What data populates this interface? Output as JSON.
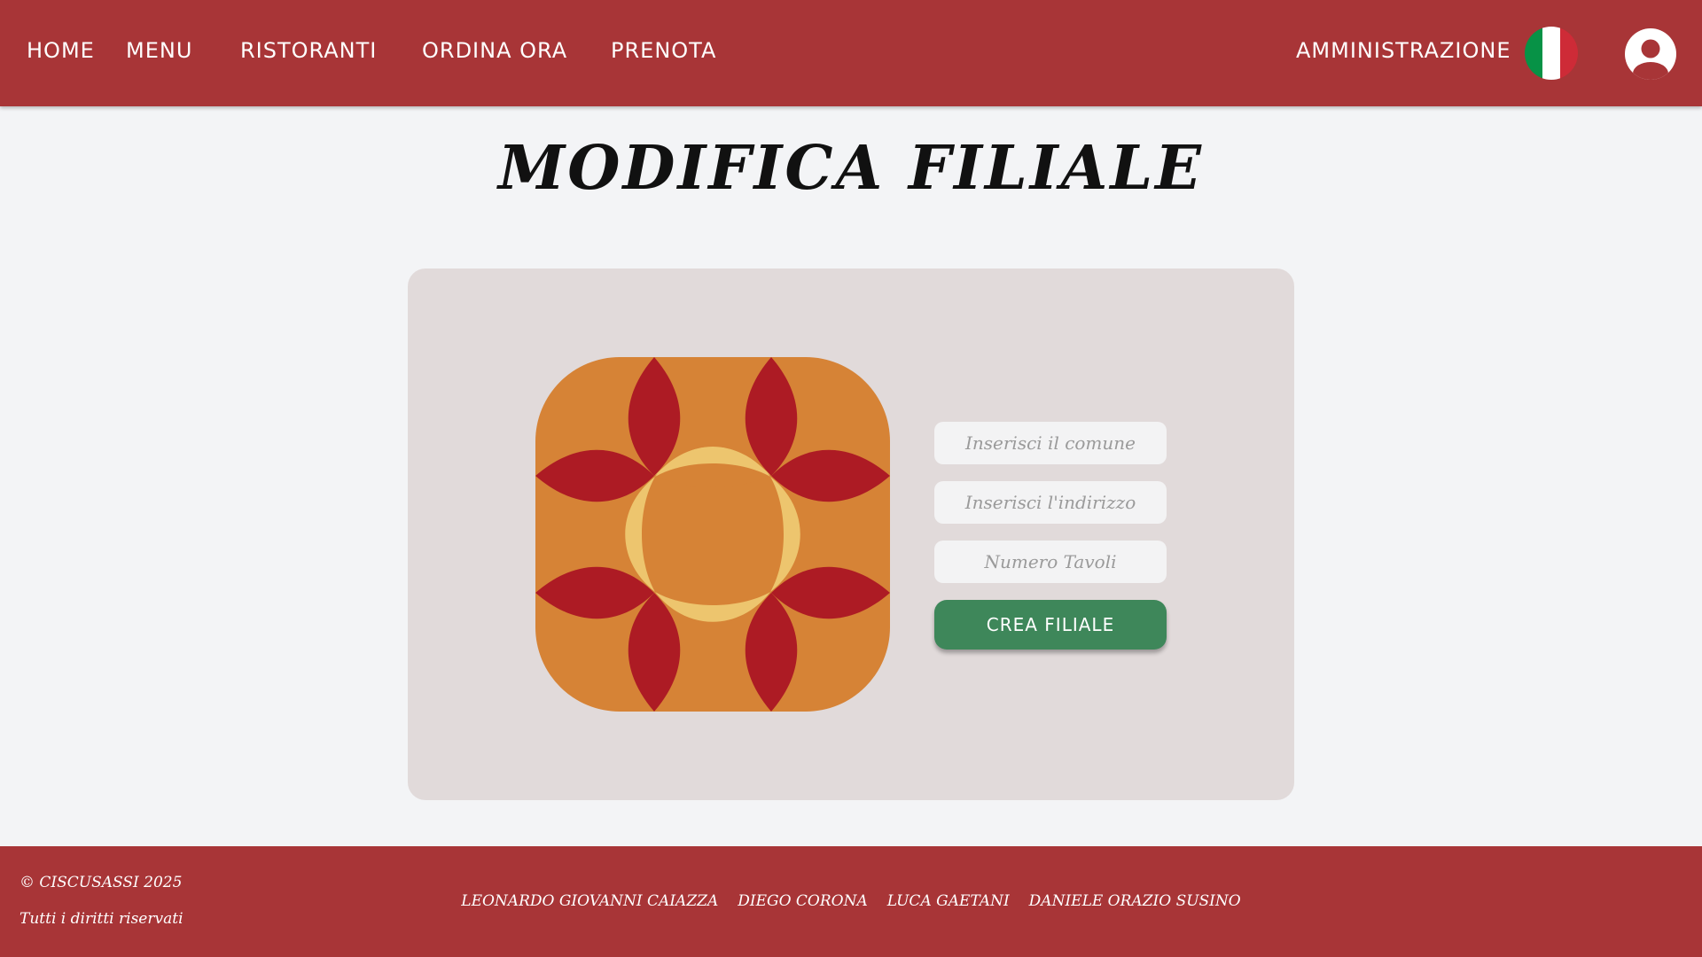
{
  "nav": {
    "home": "HOME",
    "menu": "MENU",
    "ristoranti": "RISTORANTI",
    "ordina": "ORDINA ORA",
    "prenota": "PRENOTA",
    "admin": "AMMINISTRAZIONE"
  },
  "icons": {
    "flag": "italian-flag-icon",
    "avatar": "user-avatar-icon",
    "logo": "restaurant-logo"
  },
  "page": {
    "title": "MODIFICA FILIALE"
  },
  "form": {
    "comune_placeholder": "Inserisci il comune",
    "indirizzo_placeholder": "Inserisci l'indirizzo",
    "tavoli_placeholder": "Numero Tavoli",
    "comune_value": "",
    "indirizzo_value": "",
    "tavoli_value": "",
    "submit_label": "CREA FILIALE"
  },
  "footer": {
    "copyright": "© CISCUSASSI 2025",
    "rights": "Tutti i diritti riservati",
    "authors": [
      "LEONARDO GIOVANNI CAIAZZA",
      "DIEGO CORONA",
      "LUCA GAETANI",
      "DANIELE ORAZIO SUSINO"
    ]
  },
  "colors": {
    "brand_red": "#a83537",
    "page_bg": "#f3f4f6",
    "card_bg": "#e1dada",
    "button_green": "#3e875a",
    "logo_orange": "#d68336",
    "logo_red": "#ad1b24",
    "logo_yellow": "#edc56e",
    "flag_green": "#079246",
    "flag_white": "#ffffff",
    "flag_red": "#ce2b37"
  }
}
